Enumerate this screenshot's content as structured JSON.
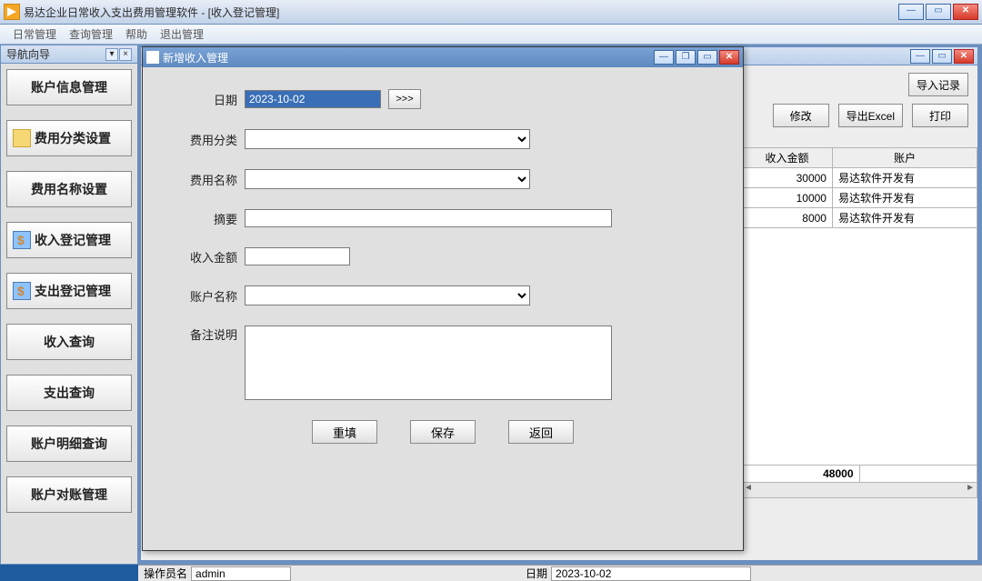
{
  "app": {
    "title": "易达企业日常收入支出费用管理软件  -  [收入登记管理]"
  },
  "menubar": {
    "items": [
      "日常管理",
      "查询管理",
      "帮助",
      "退出管理"
    ]
  },
  "nav": {
    "header": "导航向导",
    "items": [
      {
        "label": "账户信息管理",
        "icon": null
      },
      {
        "label": "费用分类设置",
        "icon": "folder"
      },
      {
        "label": "费用名称设置",
        "icon": null
      },
      {
        "label": "收入登记管理",
        "icon": "doc"
      },
      {
        "label": "支出登记管理",
        "icon": "doc"
      },
      {
        "label": "收入查询",
        "icon": null
      },
      {
        "label": "支出查询",
        "icon": null
      },
      {
        "label": "账户明细查询",
        "icon": null
      },
      {
        "label": "账户对账管理",
        "icon": null
      }
    ]
  },
  "toolbar": {
    "import": "导入记录",
    "modify": "修改",
    "export": "导出Excel",
    "print": "打印"
  },
  "table": {
    "headers": [
      "收入金额",
      "账户"
    ],
    "rows": [
      {
        "amount": "30000",
        "account": "易达软件开发有"
      },
      {
        "amount": "10000",
        "account": "易达软件开发有"
      },
      {
        "amount": "8000",
        "account": "易达软件开发有"
      }
    ],
    "total": "48000"
  },
  "dialog": {
    "title": "新增收入管理",
    "labels": {
      "date": "日期",
      "category": "费用分类",
      "name": "费用名称",
      "summary": "摘要",
      "amount": "收入金额",
      "account": "账户名称",
      "remark": "备注说明"
    },
    "values": {
      "date": "2023-10-02",
      "category": "",
      "name": "",
      "summary": "",
      "amount": "",
      "account": "",
      "remark": ""
    },
    "date_btn": ">>>",
    "buttons": {
      "reset": "重填",
      "save": "保存",
      "back": "返回"
    }
  },
  "status": {
    "operator_label": "操作员名",
    "operator_value": "admin",
    "date_label": "日期",
    "date_value": "2023-10-02"
  }
}
